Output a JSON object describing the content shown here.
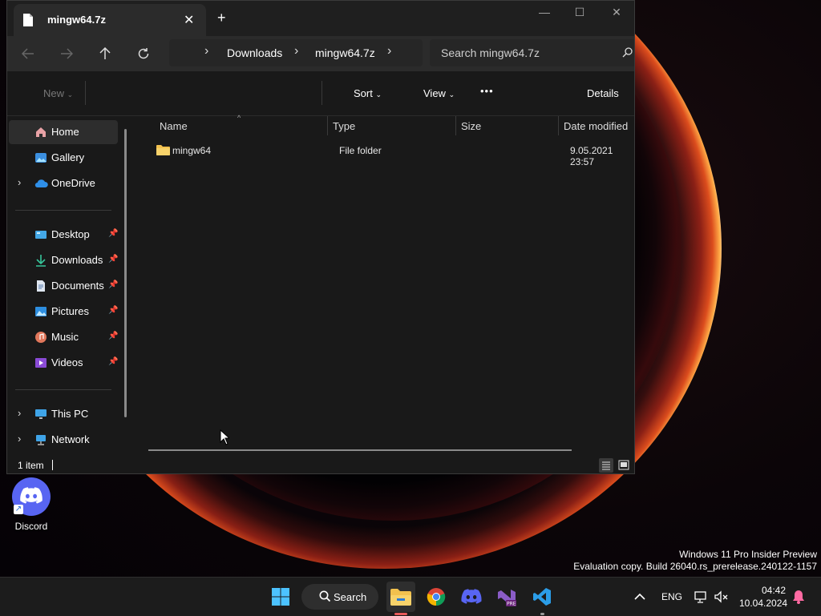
{
  "window": {
    "tab_title": "mingw64.7z",
    "controls": {
      "minimize": "—",
      "maximize": "☐",
      "close": "✕"
    },
    "breadcrumb": [
      "Downloads",
      "mingw64.7z"
    ],
    "search_placeholder": "Search mingw64.7z",
    "toolbar": {
      "new": "New",
      "sort": "Sort",
      "view": "View",
      "more": "•••",
      "details": "Details"
    },
    "sidebar": {
      "items": [
        {
          "label": "Home",
          "icon": "home-icon",
          "selected": true
        },
        {
          "label": "Gallery",
          "icon": "gallery-icon"
        },
        {
          "label": "OneDrive",
          "icon": "onedrive-icon",
          "expandable": true
        }
      ],
      "quick_access": [
        {
          "label": "Desktop",
          "icon": "desktop-folder-icon",
          "pinned": true
        },
        {
          "label": "Downloads",
          "icon": "download-icon",
          "pinned": true
        },
        {
          "label": "Documents",
          "icon": "documents-icon",
          "pinned": true
        },
        {
          "label": "Pictures",
          "icon": "pictures-icon",
          "pinned": true
        },
        {
          "label": "Music",
          "icon": "music-icon",
          "pinned": true
        },
        {
          "label": "Videos",
          "icon": "videos-icon",
          "pinned": true
        }
      ],
      "locations": [
        {
          "label": "This PC",
          "icon": "monitor-icon",
          "expandable": true
        },
        {
          "label": "Network",
          "icon": "network-icon",
          "expandable": true
        }
      ]
    },
    "columns": [
      "Name",
      "Type",
      "Size",
      "Date modified"
    ],
    "rows": [
      {
        "name": "mingw64",
        "type": "File folder",
        "size": "",
        "date": "9.05.2021 23:57",
        "icon": "folder-icon"
      }
    ],
    "status": "1 item"
  },
  "desktop": {
    "icons": [
      {
        "label": "Discord",
        "icon": "discord-icon"
      }
    ],
    "watermark_line1": "Windows 11 Pro Insider Preview",
    "watermark_line2": "Evaluation copy. Build 26040.rs_prerelease.240122-1157"
  },
  "taskbar": {
    "search_label": "Search",
    "language": "ENG",
    "time": "04:42",
    "date": "10.04.2024",
    "apps": [
      "start-icon",
      "search-icon",
      "file-explorer-icon",
      "chrome-icon",
      "discord-icon",
      "visual-studio-preview-icon",
      "vscode-icon"
    ]
  },
  "colors": {
    "accent": "#4cc2ff",
    "folder": "#f2c14e",
    "active_indicator": "#e85a5a"
  }
}
